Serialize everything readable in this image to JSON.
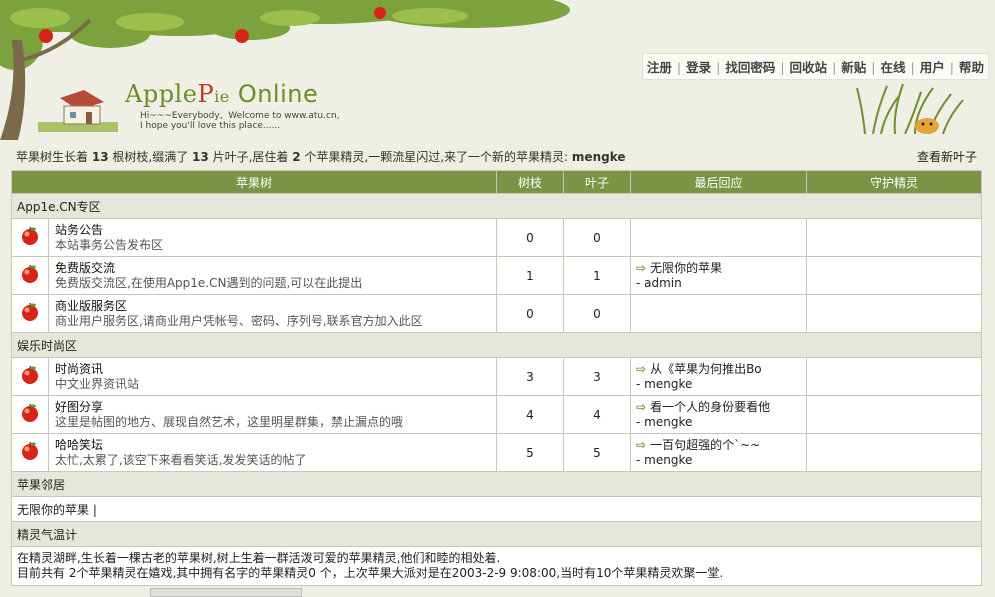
{
  "nav": {
    "items": [
      "注册",
      "登录",
      "找回密码",
      "回收站",
      "新贴",
      "在线",
      "用户",
      "帮助"
    ]
  },
  "logo": {
    "text1": "Apple",
    "text2": "P",
    "text3": "ie",
    "text4": "Online",
    "tagline": "Hi~~~Everybody,  Welcome to www.atu.cn,\nI hope you'll love this place......"
  },
  "stats": {
    "p1": "苹果树生长着",
    "branches": "13",
    "p2": "根树枝,缀满了",
    "leaves": "13",
    "p3": "片叶子,居住着",
    "elves": "2",
    "p4": "个苹果精灵,一颗流星闪过,来了一个新的苹果精灵:",
    "newest": "mengke"
  },
  "new_leaves": "查看新叶子",
  "table": {
    "headers": [
      "苹果树",
      "树枝",
      "叶子",
      "最后回应",
      "守护精灵"
    ],
    "categories": [
      {
        "name": "App1e.CN专区",
        "forums": [
          {
            "name": "站务公告",
            "desc": "本站事务公告发布区",
            "branches": "0",
            "leaves": "0",
            "last_title": "",
            "last_user": ""
          },
          {
            "name": "免费版交流",
            "desc": "免费版交流区,在使用App1e.CN遇到的问题,可以在此提出",
            "branches": "1",
            "leaves": "1",
            "last_title": "无限你的苹果",
            "last_user": "- admin"
          },
          {
            "name": "商业版服务区",
            "desc": "商业用户服务区,请商业用户凭帐号、密码、序列号,联系官方加入此区",
            "branches": "0",
            "leaves": "0",
            "last_title": "",
            "last_user": ""
          }
        ]
      },
      {
        "name": "娱乐时尚区",
        "forums": [
          {
            "name": "时尚资讯",
            "desc": "中文业界资讯站",
            "branches": "3",
            "leaves": "3",
            "last_title": "从《苹果为何推出Bo",
            "last_user": "- mengke"
          },
          {
            "name": "好图分享",
            "desc": "这里是帖图的地方、展现自然艺术，这里明星群集，禁止漏点的哦",
            "branches": "4",
            "leaves": "4",
            "last_title": "看一个人的身份要看他",
            "last_user": "- mengke"
          },
          {
            "name": "哈哈笑坛",
            "desc": "太忙,太累了,该空下来看看笑话,发发笑话的帖了",
            "branches": "5",
            "leaves": "5",
            "last_title": "一百句超强的个`~~",
            "last_user": "- mengke"
          }
        ]
      }
    ]
  },
  "neighbors": {
    "title": "苹果邻居",
    "link": "无限你的苹果",
    "sep": "|"
  },
  "weather": {
    "title": "精灵气温计",
    "line1": "在精灵湖畔,生长着一棵古老的苹果树,树上生着一群活泼可爱的苹果精灵,他们和睦的相处着.",
    "line2": "目前共有  2个苹果精灵在嬉戏,其中拥有名字的苹果精灵0 个，上次苹果大派对是在2003-2-9 9:08:00,当时有10个苹果精灵欢聚一堂."
  },
  "colors": {
    "header_bg": "#7a9344",
    "accent": "#6b8e23",
    "cat_bg": "#e6e6da",
    "apple_red": "#d8231a"
  }
}
